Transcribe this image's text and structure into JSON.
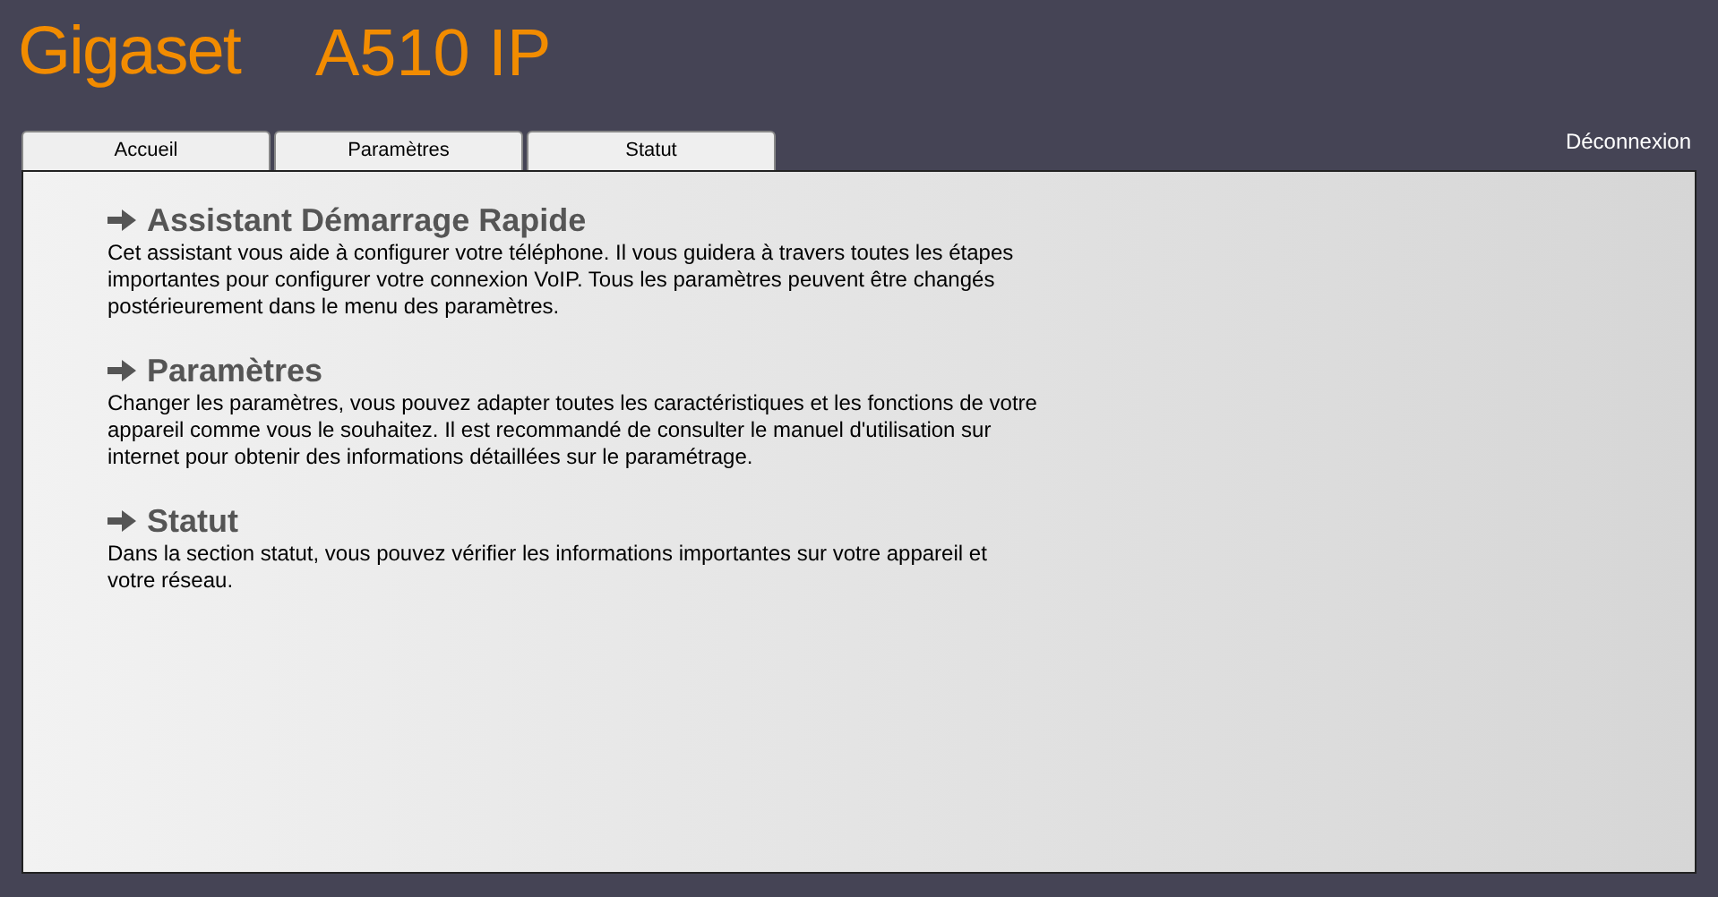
{
  "header": {
    "brand": "Gigaset",
    "model": "A510 IP"
  },
  "tabs": [
    {
      "label": "Accueil",
      "selected": false
    },
    {
      "label": "Paramètres",
      "selected": false
    },
    {
      "label": "Statut",
      "selected": false
    }
  ],
  "logout": "Déconnexion",
  "sections": [
    {
      "title": "Assistant Démarrage Rapide",
      "text": "Cet assistant vous aide à configurer votre téléphone. Il vous guidera à travers toutes les étapes importantes pour configurer votre connexion VoIP. Tous les paramètres peuvent être changés postérieurement dans le menu des paramètres."
    },
    {
      "title": "Paramètres",
      "text": "Changer les paramètres, vous pouvez adapter toutes les caractéristiques et les fonctions de votre appareil comme vous le souhaitez. Il est recommandé de consulter le manuel d'utilisation sur internet pour obtenir des informations détaillées sur le paramétrage."
    },
    {
      "title": "Statut",
      "text": "Dans la section statut, vous pouvez vérifier les informations importantes sur votre appareil et votre réseau."
    }
  ]
}
